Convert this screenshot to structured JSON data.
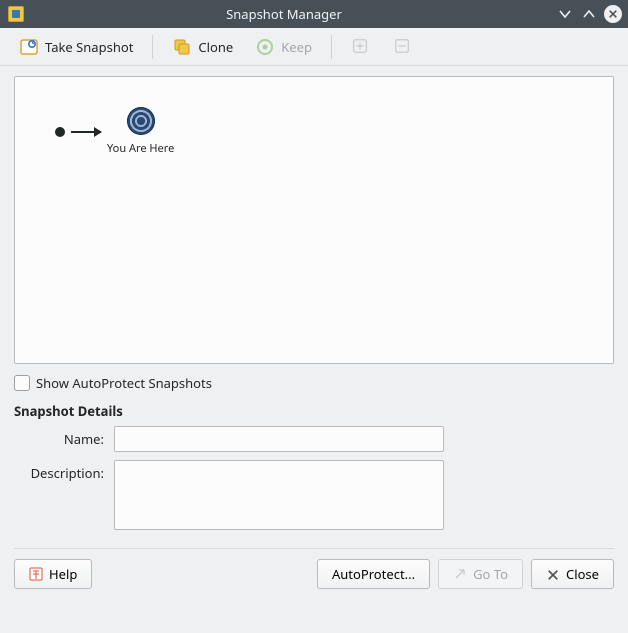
{
  "window": {
    "title": "Snapshot Manager"
  },
  "toolbar": {
    "take_snapshot": "Take Snapshot",
    "clone": "Clone",
    "keep": "Keep"
  },
  "tree": {
    "current_label": "You Are Here"
  },
  "options": {
    "show_autoprotect": "Show AutoProtect Snapshots"
  },
  "details": {
    "section_title": "Snapshot Details",
    "name_label": "Name:",
    "description_label": "Description:",
    "name_value": "",
    "description_value": ""
  },
  "footer": {
    "help": "Help",
    "autoprotect": "AutoProtect...",
    "goto": "Go To",
    "close": "Close"
  }
}
